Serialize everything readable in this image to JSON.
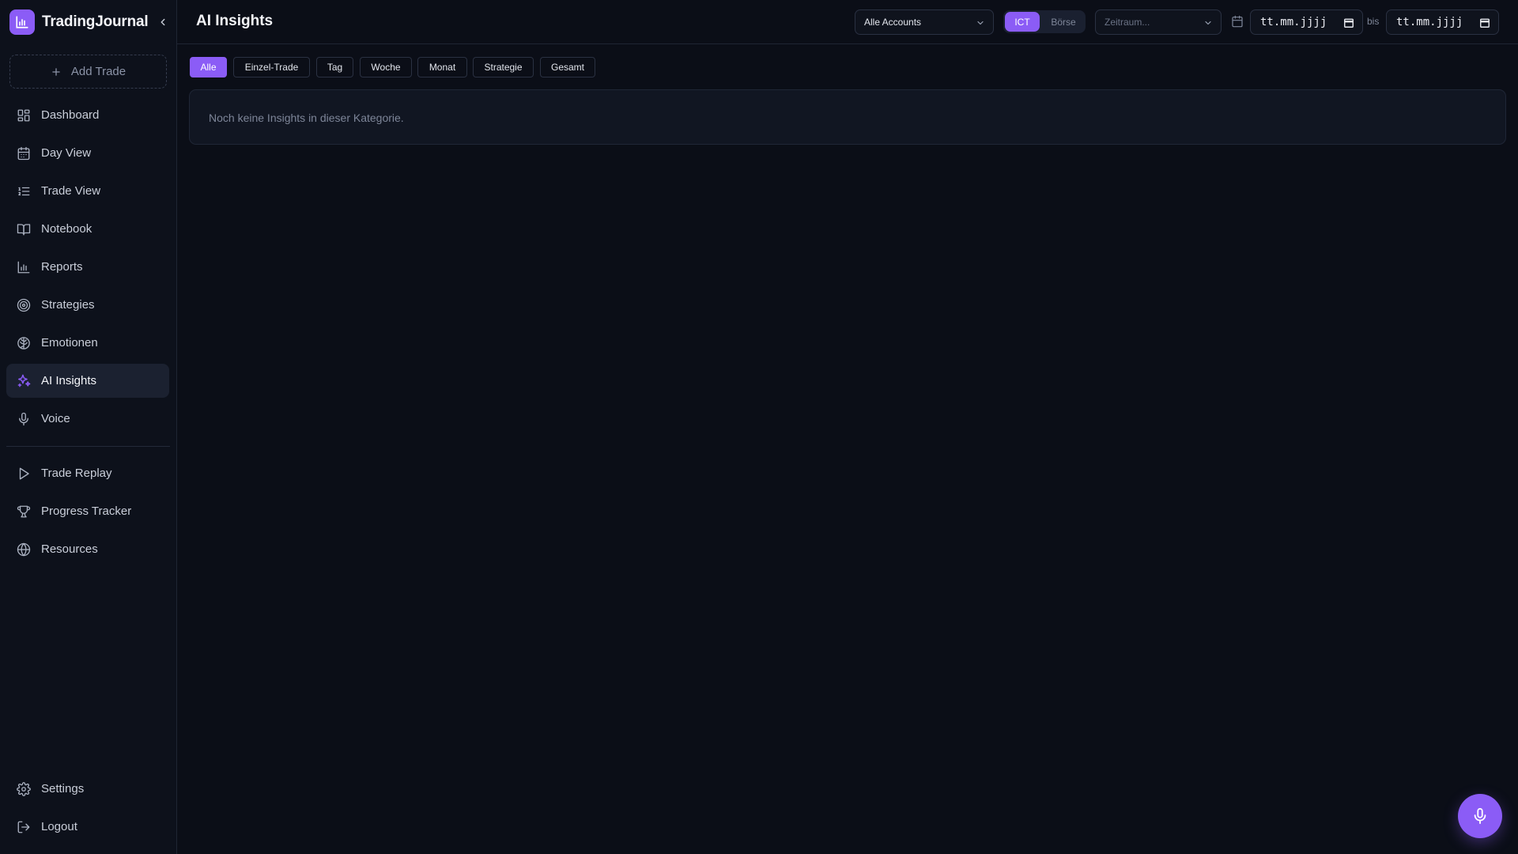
{
  "app": {
    "name": "TradingJournal",
    "logo_icon": "bar-chart-icon",
    "accent_color": "#8b5cf6"
  },
  "sidebar": {
    "add_trade_label": "Add Trade",
    "items": [
      {
        "label": "Dashboard",
        "icon": "layout-dashboard-icon"
      },
      {
        "label": "Day View",
        "icon": "calendar-icon"
      },
      {
        "label": "Trade View",
        "icon": "list-ordered-icon"
      },
      {
        "label": "Notebook",
        "icon": "book-open-icon"
      },
      {
        "label": "Reports",
        "icon": "bar-chart-icon"
      },
      {
        "label": "Strategies",
        "icon": "target-icon"
      },
      {
        "label": "Emotionen",
        "icon": "brain-icon"
      },
      {
        "label": "AI Insights",
        "icon": "sparkles-icon",
        "active": true
      },
      {
        "label": "Voice",
        "icon": "mic-icon"
      }
    ],
    "secondary_items": [
      {
        "label": "Trade Replay",
        "icon": "play-icon"
      },
      {
        "label": "Progress Tracker",
        "icon": "trophy-icon"
      },
      {
        "label": "Resources",
        "icon": "globe-icon"
      }
    ],
    "bottom_items": [
      {
        "label": "Settings",
        "icon": "gear-icon"
      },
      {
        "label": "Logout",
        "icon": "log-out-icon"
      }
    ]
  },
  "header": {
    "title": "AI Insights",
    "accounts_select": {
      "value": "Alle Accounts"
    },
    "market_toggle": {
      "options": [
        "ICT",
        "Börse"
      ],
      "selected": "ICT"
    },
    "period_select": {
      "placeholder": "Zeitraum..."
    },
    "date_from": {
      "placeholder": "tt.mm.jjjj"
    },
    "date_separator": "bis",
    "date_to": {
      "placeholder": "tt.mm.jjjj"
    }
  },
  "filters": {
    "chips": [
      "Alle",
      "Einzel-Trade",
      "Tag",
      "Woche",
      "Monat",
      "Strategie",
      "Gesamt"
    ],
    "selected": "Alle"
  },
  "main": {
    "empty_message": "Noch keine Insights in dieser Kategorie."
  },
  "fab": {
    "icon": "mic-icon"
  }
}
